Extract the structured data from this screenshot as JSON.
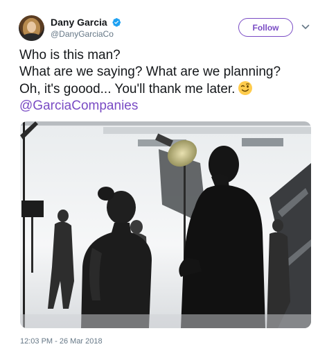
{
  "user": {
    "name": "Dany Garcia",
    "handle": "@DanyGarciaCo",
    "verified": true
  },
  "actions": {
    "follow_label": "Follow",
    "menu_icon": "chevron-down-icon"
  },
  "tweet": {
    "lines": [
      "Who is this man?",
      "What are we saying? What are we planning?",
      "Oh, it's goood... You'll thank me later."
    ],
    "emoji": "winking-face-emoji",
    "mention": "@GarciaCompanies",
    "timestamp": "12:03 PM - 26 Mar 2018"
  },
  "colors": {
    "accent": "#794bc4",
    "verified": "#1da1f2",
    "text": "#14171a",
    "secondary": "#657786"
  }
}
